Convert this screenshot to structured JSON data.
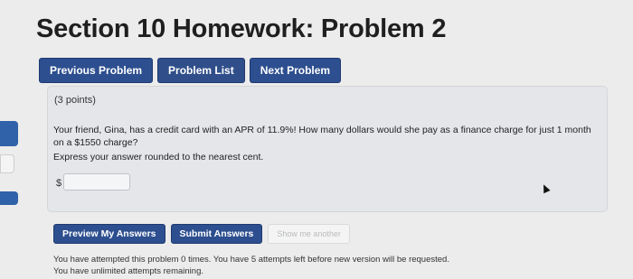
{
  "page": {
    "title": "Section 10 Homework: Problem 2"
  },
  "nav": {
    "previous_label": "Previous Problem",
    "list_label": "Problem List",
    "next_label": "Next Problem"
  },
  "problem": {
    "points": "(3 points)",
    "question": "Your friend, Gina, has a credit card with an APR of 11.9%! How many dollars would she pay as a finance charge for just 1 month on a $1550 charge?",
    "instruction": "Express your answer rounded to the nearest cent.",
    "answer_prefix": "$",
    "answer_value": ""
  },
  "actions": {
    "preview_label": "Preview My Answers",
    "submit_label": "Submit Answers",
    "show_another_label": "Show me another"
  },
  "status": {
    "attempts_line": "You have attempted this problem 0 times. You have 5 attempts left before new version will be requested.",
    "unlimited_line": "You have unlimited attempts remaining."
  },
  "colors": {
    "accent": "#2d4f8f",
    "background": "#ececec",
    "panel": "#e4e6e9"
  },
  "icons": {
    "cursor": "mouse-pointer-icon"
  }
}
